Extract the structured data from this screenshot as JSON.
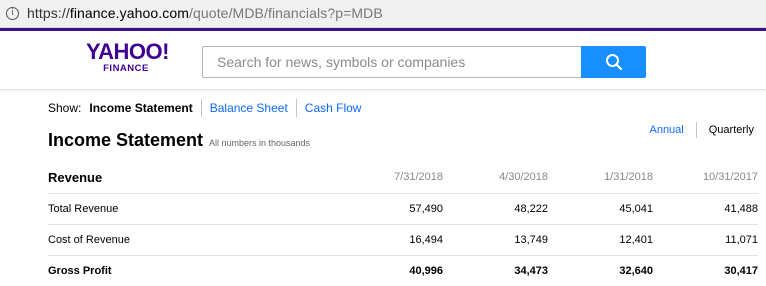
{
  "browser": {
    "url_prefix": "https://",
    "url_host": "finance.yahoo.com",
    "url_path": "/quote/MDB/financials?p=MDB"
  },
  "header": {
    "logo_main": "YAHOO!",
    "logo_sub": "FINANCE",
    "search_placeholder": "Search for news, symbols or companies",
    "brand_color": "#400090",
    "accent_color": "#188fff"
  },
  "tabs": {
    "show_label": "Show:",
    "items": [
      {
        "label": "Income Statement",
        "active": true
      },
      {
        "label": "Balance Sheet",
        "active": false
      },
      {
        "label": "Cash Flow",
        "active": false
      }
    ]
  },
  "statement": {
    "title": "Income Statement",
    "note": "All numbers in thousands",
    "period_annual": "Annual",
    "period_quarterly": "Quarterly"
  },
  "table": {
    "header": {
      "label": "Revenue",
      "dates": [
        "7/31/2018",
        "4/30/2018",
        "1/31/2018",
        "10/31/2017"
      ]
    },
    "rows": [
      {
        "label": "Total Revenue",
        "values": [
          "57,490",
          "48,222",
          "45,041",
          "41,488"
        ]
      },
      {
        "label": "Cost of Revenue",
        "values": [
          "16,494",
          "13,749",
          "12,401",
          "11,071"
        ]
      },
      {
        "label": "Gross Profit",
        "values": [
          "40,996",
          "34,473",
          "32,640",
          "30,417"
        ]
      }
    ]
  }
}
